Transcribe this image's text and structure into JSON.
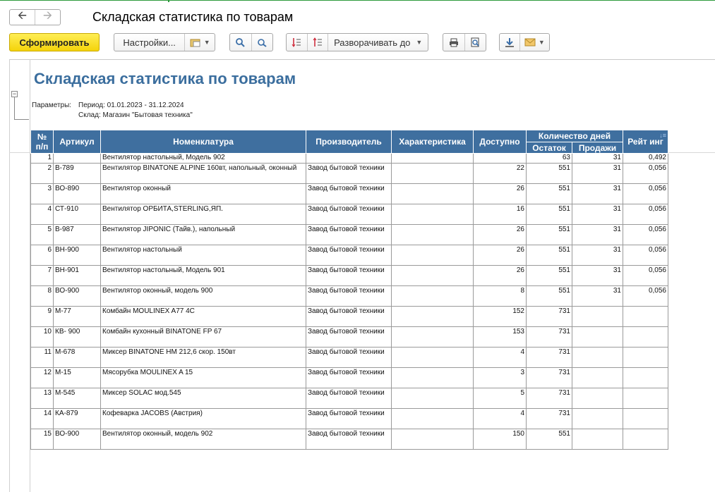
{
  "window": {
    "title": "Складская статистика по товарам"
  },
  "toolbar": {
    "generate": "Сформировать",
    "settings": "Настройки...",
    "expand": "Разворачивать до"
  },
  "report": {
    "title": "Складская статистика по товарам",
    "params_label": "Параметры:",
    "params": [
      "Период: 01.01.2023 - 31.12.2024",
      "Склад: Магазин \"Бытовая техника\""
    ]
  },
  "table": {
    "headers": {
      "num": "№ п/п",
      "article": "Артикул",
      "nomenclature": "Номенклатура",
      "manufacturer": "Производитель",
      "characteristic": "Характеристика",
      "available": "Доступно",
      "days": "Количество дней",
      "balance": "Остаток",
      "sales": "Продажи",
      "rating": "Рейт инг"
    },
    "rows": [
      {
        "n": "1",
        "art": "",
        "nom": "Вентилятор настольный, Модель 902",
        "man": "",
        "ch": "",
        "av": "",
        "bal": "63",
        "sal": "31",
        "rat": "0,492"
      },
      {
        "n": "2",
        "art": "B-789",
        "nom": "Вентилятор BINATONE ALPINE 160вт, напольный, оконный",
        "man": "Завод бытовой техники",
        "ch": "",
        "av": "22",
        "bal": "551",
        "sal": "31",
        "rat": "0,056"
      },
      {
        "n": "3",
        "art": "ВО-890",
        "nom": "Вентилятор оконный",
        "man": "Завод бытовой техники",
        "ch": "",
        "av": "26",
        "bal": "551",
        "sal": "31",
        "rat": "0,056"
      },
      {
        "n": "4",
        "art": "СТ-910",
        "nom": "Вентилятор ОРБИТА,STERLING,ЯП.",
        "man": "Завод бытовой техники",
        "ch": "",
        "av": "16",
        "bal": "551",
        "sal": "31",
        "rat": "0,056"
      },
      {
        "n": "5",
        "art": "B-987",
        "nom": "Вентилятор JIPONIC (Тайв.), напольный",
        "man": "Завод бытовой техники",
        "ch": "",
        "av": "26",
        "bal": "551",
        "sal": "31",
        "rat": "0,056"
      },
      {
        "n": "6",
        "art": "ВН-900",
        "nom": "Вентилятор настольный",
        "man": "Завод бытовой техники",
        "ch": "",
        "av": "26",
        "bal": "551",
        "sal": "31",
        "rat": "0,056"
      },
      {
        "n": "7",
        "art": "ВН-901",
        "nom": "Вентилятор настольный, Модель 901",
        "man": "Завод бытовой техники",
        "ch": "",
        "av": "26",
        "bal": "551",
        "sal": "31",
        "rat": "0,056"
      },
      {
        "n": "8",
        "art": "ВО-900",
        "nom": "Вентилятор оконный, модель 900",
        "man": "Завод бытовой техники",
        "ch": "",
        "av": "8",
        "bal": "551",
        "sal": "31",
        "rat": "0,056"
      },
      {
        "n": "9",
        "art": "М-77",
        "nom": "Комбайн MOULINEX A77 4C",
        "man": "Завод бытовой техники",
        "ch": "",
        "av": "152",
        "bal": "731",
        "sal": "",
        "rat": ""
      },
      {
        "n": "10",
        "art": "КВ- 900",
        "nom": "Комбайн кухонный BINATONE FP 67",
        "man": "Завод бытовой техники",
        "ch": "",
        "av": "153",
        "bal": "731",
        "sal": "",
        "rat": ""
      },
      {
        "n": "11",
        "art": "М-678",
        "nom": "Миксер BINATONE HM 212,6 скор. 150вт",
        "man": "Завод бытовой техники",
        "ch": "",
        "av": "4",
        "bal": "731",
        "sal": "",
        "rat": ""
      },
      {
        "n": "12",
        "art": "М-15",
        "nom": "Мясорубка MOULINEX A 15",
        "man": "Завод бытовой техники",
        "ch": "",
        "av": "3",
        "bal": "731",
        "sal": "",
        "rat": ""
      },
      {
        "n": "13",
        "art": "М-545",
        "nom": "Миксер SOLAC мод.545",
        "man": "Завод бытовой техники",
        "ch": "",
        "av": "5",
        "bal": "731",
        "sal": "",
        "rat": ""
      },
      {
        "n": "14",
        "art": "КА-879",
        "nom": "Кофеварка JACOBS (Австрия)",
        "man": "Завод бытовой техники",
        "ch": "",
        "av": "4",
        "bal": "731",
        "sal": "",
        "rat": ""
      },
      {
        "n": "15",
        "art": "ВО-900",
        "nom": "Вентилятор оконный, модель 902",
        "man": "Завод бытовой техники",
        "ch": "",
        "av": "150",
        "bal": "551",
        "sal": "",
        "rat": ""
      }
    ]
  }
}
